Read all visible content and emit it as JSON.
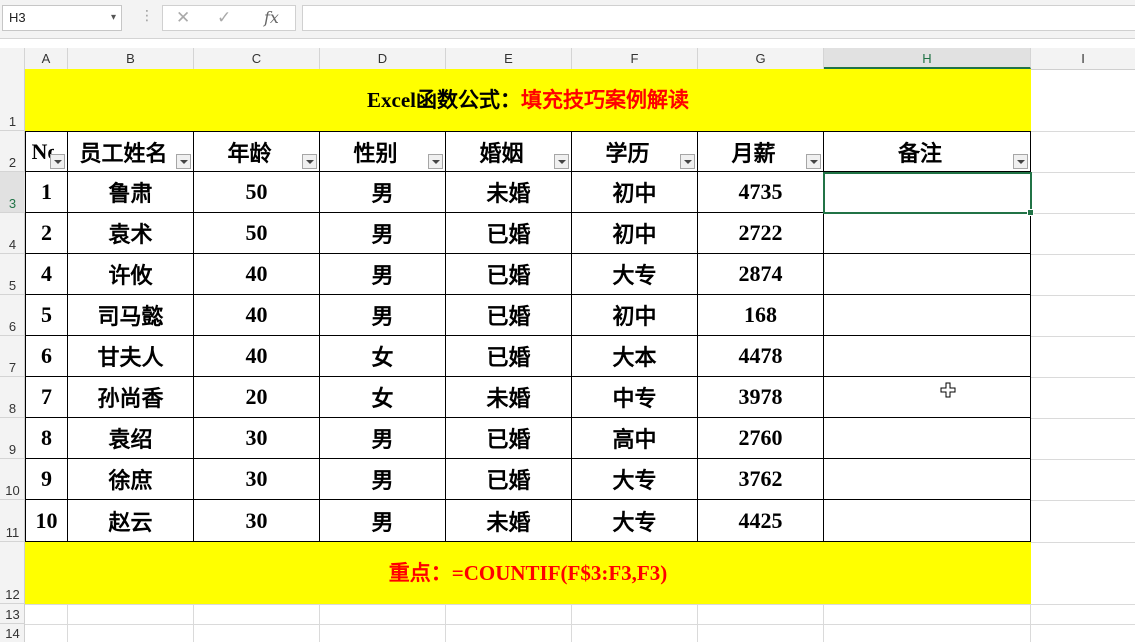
{
  "namebox": {
    "value": "H3"
  },
  "formula": {
    "value": ""
  },
  "columns": [
    "A",
    "B",
    "C",
    "D",
    "E",
    "F",
    "G",
    "H",
    "I"
  ],
  "rows": [
    "1",
    "2",
    "3",
    "4",
    "5",
    "6",
    "7",
    "8",
    "9",
    "10",
    "11",
    "12",
    "13",
    "14"
  ],
  "title": {
    "part1": "Excel函数公式：",
    "part2": "填充技巧案例解读"
  },
  "table": {
    "headers": [
      "No",
      "员工姓名",
      "年龄",
      "性别",
      "婚姻",
      "学历",
      "月薪",
      "备注"
    ],
    "rows": [
      [
        "1",
        "鲁肃",
        "50",
        "男",
        "未婚",
        "初中",
        "4735",
        ""
      ],
      [
        "2",
        "袁术",
        "50",
        "男",
        "已婚",
        "初中",
        "2722",
        ""
      ],
      [
        "4",
        "许攸",
        "40",
        "男",
        "已婚",
        "大专",
        "2874",
        ""
      ],
      [
        "5",
        "司马懿",
        "40",
        "男",
        "已婚",
        "初中",
        "168",
        ""
      ],
      [
        "6",
        "甘夫人",
        "40",
        "女",
        "已婚",
        "大本",
        "4478",
        ""
      ],
      [
        "7",
        "孙尚香",
        "20",
        "女",
        "未婚",
        "中专",
        "3978",
        ""
      ],
      [
        "8",
        "袁绍",
        "30",
        "男",
        "已婚",
        "高中",
        "2760",
        ""
      ],
      [
        "9",
        "徐庶",
        "30",
        "男",
        "已婚",
        "大专",
        "3762",
        ""
      ],
      [
        "10",
        "赵云",
        "30",
        "男",
        "未婚",
        "大专",
        "4425",
        ""
      ]
    ]
  },
  "footer": {
    "text": "重点：=COUNTIF(F$3:F3,F3)"
  },
  "selected_cell": "H3",
  "colors": {
    "banner": "#ffff00",
    "accent_red": "#ff0000",
    "selection": "#217346"
  }
}
